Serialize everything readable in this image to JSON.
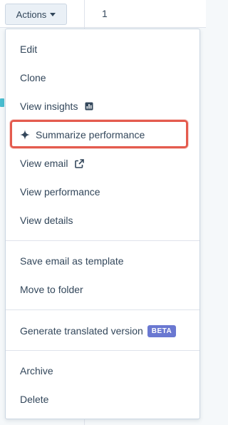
{
  "toolbar": {
    "actions_label": "Actions"
  },
  "table": {
    "first_cell_value": "1"
  },
  "menu": {
    "items": [
      {
        "label": "Edit"
      },
      {
        "label": "Clone"
      },
      {
        "label": "View insights",
        "icon": "chart-icon"
      },
      {
        "label": "Summarize performance",
        "icon": "sparkle-icon",
        "highlighted": true
      },
      {
        "label": "View email",
        "icon": "external-link-icon"
      },
      {
        "label": "View performance"
      },
      {
        "label": "View details"
      },
      {
        "label": "Save email as template"
      },
      {
        "label": "Move to folder"
      },
      {
        "label": "Generate translated version",
        "badge": "BETA"
      },
      {
        "label": "Archive"
      },
      {
        "label": "Delete"
      }
    ]
  },
  "colors": {
    "text": "#33475b",
    "border": "#cbd6e2",
    "highlight": "#e45b4e",
    "beta_badge": "#6a78d1"
  }
}
